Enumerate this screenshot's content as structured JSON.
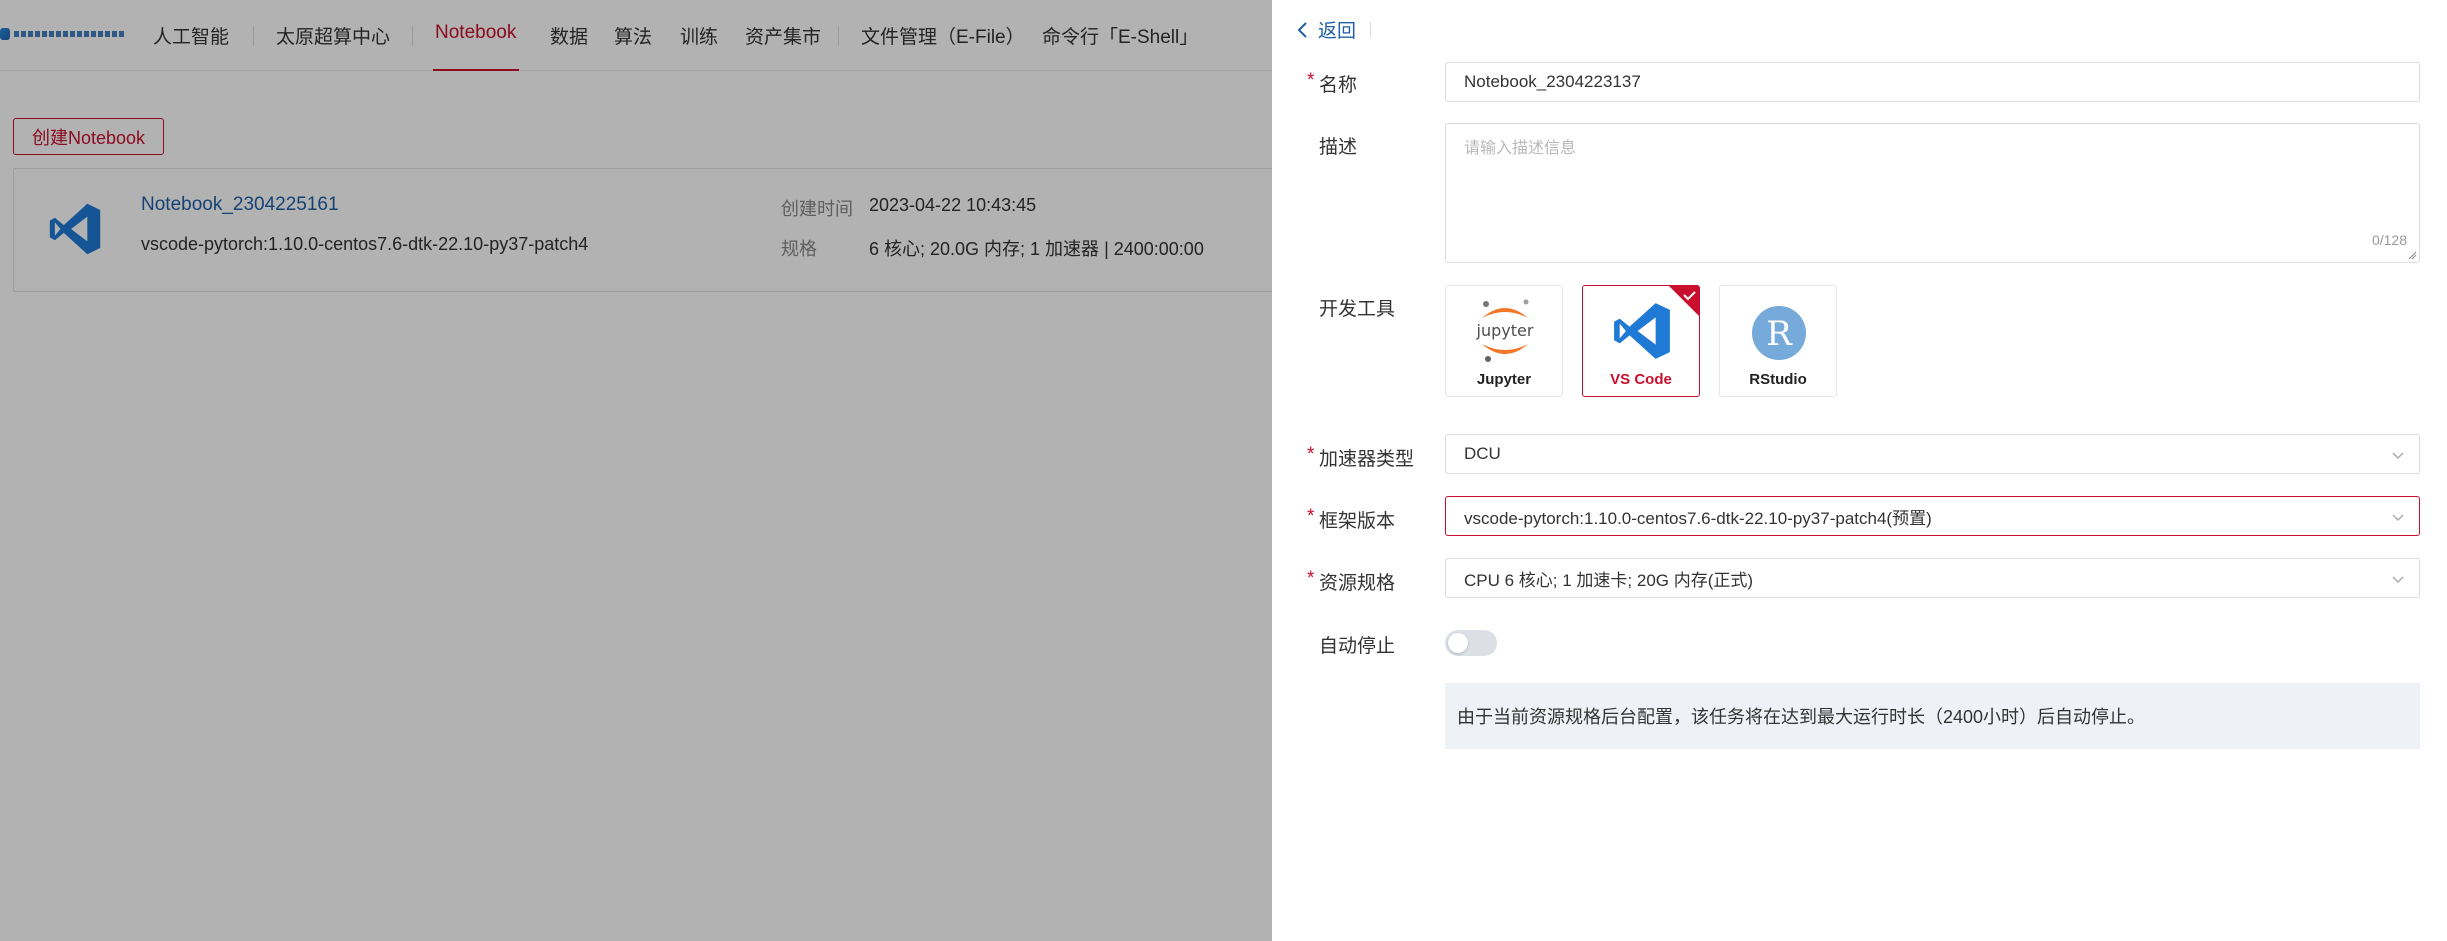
{
  "nav": {
    "items": [
      "人工智能",
      "太原超算中心",
      "Notebook",
      "数据",
      "算法",
      "训练",
      "资产集市",
      "文件管理（E-File）",
      "命令行「E-Shell」"
    ],
    "active": "Notebook"
  },
  "page": {
    "create_button": "创建Notebook",
    "notebook": {
      "name": "Notebook_2304225161",
      "image": "vscode-pytorch:1.10.0-centos7.6-dtk-22.10-py37-patch4",
      "created_label": "创建时间",
      "created_value": "2023-04-22 10:43:45",
      "spec_label": "规格",
      "spec_value": "6 核心; 20.0G 内存; 1 加速器 | 2400:00:00"
    }
  },
  "drawer": {
    "back_label": "返回",
    "required_mark": "*",
    "name": {
      "label": "名称",
      "value": "Notebook_2304223137"
    },
    "description": {
      "label": "描述",
      "placeholder": "请输入描述信息",
      "counter": "0/128"
    },
    "dev_tools": {
      "label": "开发工具",
      "options": [
        {
          "name": "Jupyter",
          "icon": "jupyter-logo",
          "selected": false
        },
        {
          "name": "VS Code",
          "icon": "vscode-logo",
          "selected": true
        },
        {
          "name": "RStudio",
          "icon": "rstudio-logo",
          "selected": false
        }
      ],
      "jupyter_wordmark": "jupyter",
      "rstudio_letter": "R"
    },
    "accelerator": {
      "label": "加速器类型",
      "value": "DCU"
    },
    "framework": {
      "label": "框架版本",
      "value": "vscode-pytorch:1.10.0-centos7.6-dtk-22.10-py37-patch4(预置)"
    },
    "resource": {
      "label": "资源规格",
      "value": "CPU 6 核心; 1 加速卡; 20G 内存(正式)"
    },
    "auto_stop": {
      "label": "自动停止",
      "enabled": false
    },
    "notice": "由于当前资源规格后台配置，该任务将在达到最大运行时长（2400小时）后自动停止。"
  },
  "colors": {
    "accent": "#c8102e",
    "link": "#1f5fa8",
    "vscode_blue": "#0078d4",
    "notice_bg": "#eef1f6"
  }
}
